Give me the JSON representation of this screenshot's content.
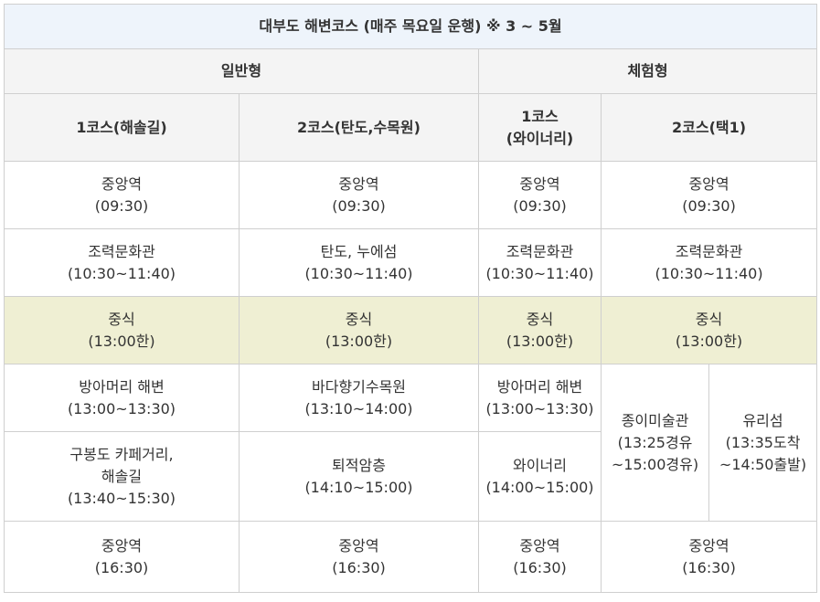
{
  "title": "대부도 해변코스 (매주 목요일 운행) ※ 3 ~ 5월",
  "groups": {
    "general": "일반형",
    "experience": "체험형"
  },
  "courses": {
    "g1": "1코스(해솔길)",
    "g2": "2코스(탄도,수목원)",
    "e1_line1": "1코스",
    "e1_line2": "(와이너리)",
    "e2": "2코스(택1)"
  },
  "rows": {
    "depart": {
      "g1": [
        "중앙역",
        "(09:30)"
      ],
      "g2": [
        "중앙역",
        "(09:30)"
      ],
      "e1": [
        "중앙역",
        "(09:30)"
      ],
      "e2": [
        "중앙역",
        "(09:30)"
      ]
    },
    "stop1": {
      "g1": [
        "조력문화관",
        "(10:30~11:40)"
      ],
      "g2": [
        "탄도, 누에섬",
        "(10:30~11:40)"
      ],
      "e1": [
        "조력문화관",
        "(10:30~11:40)"
      ],
      "e2": [
        "조력문화관",
        "(10:30~11:40)"
      ]
    },
    "lunch": {
      "g1": [
        "중식",
        "(13:00한)"
      ],
      "g2": [
        "중식",
        "(13:00한)"
      ],
      "e1": [
        "중식",
        "(13:00한)"
      ],
      "e2": [
        "중식",
        "(13:00한)"
      ]
    },
    "stop2": {
      "g1": [
        "방아머리 해변",
        "(13:00~13:30)"
      ],
      "g2": [
        "바다향기수목원",
        "(13:10~14:00)"
      ],
      "e1": [
        "방아머리 해변",
        "(13:00~13:30)"
      ],
      "e2a": [
        "종이미술관",
        "(13:25경유",
        "~15:00경유)"
      ],
      "e2b": [
        "유리섬",
        "(13:35도착",
        "~14:50출발)"
      ]
    },
    "stop3": {
      "g1": [
        "구봉도 카페거리,",
        "해솔길",
        "(13:40~15:30)"
      ],
      "g2": [
        "퇴적암층",
        "(14:10~15:00)"
      ],
      "e1": [
        "와이너리",
        "(14:00~15:00)"
      ]
    },
    "return": {
      "g1": [
        "중앙역",
        "(16:30)"
      ],
      "g2": [
        "중앙역",
        "(16:30)"
      ],
      "e1": [
        "중앙역",
        "(16:30)"
      ],
      "e2": [
        "중앙역",
        "(16:30)"
      ]
    }
  }
}
